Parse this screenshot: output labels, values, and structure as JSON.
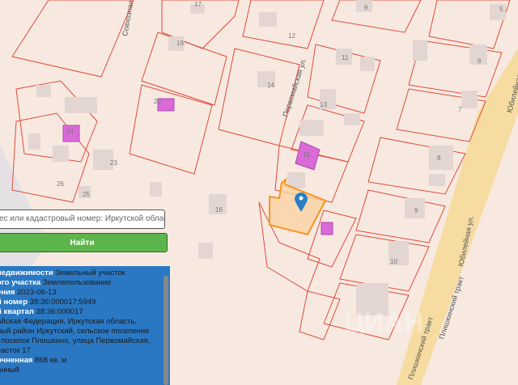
{
  "map": {
    "streets": [
      "Совхозная ул.",
      "Первомайская ул.",
      "Юбилейная ул.",
      "Плишкинский тракт"
    ],
    "house_numbers": [
      "17",
      "12",
      "9",
      "5",
      "19",
      "11",
      "6",
      "20",
      "14",
      "13",
      "7",
      "24",
      "23",
      "8",
      "15",
      "26",
      "25",
      "16",
      "9",
      "10"
    ],
    "marker": "map-pin-icon",
    "selected_color": "#f7941d",
    "parcel_color": "#e04a3a"
  },
  "search": {
    "placeholder": "ес или кадастровый номер: Иркутской области",
    "button": "Найти"
  },
  "info": {
    "rows": [
      {
        "label": "недвижимости",
        "value": "Земельный участок"
      },
      {
        "label": "ого участка",
        "value": "Землепользование"
      },
      {
        "label": "ения",
        "value": "2023-06-13"
      },
      {
        "label": "й номер",
        "value": "38:36:000017:5949"
      },
      {
        "label": "й квартал",
        "value": "38:36:000017"
      },
      {
        "label": "",
        "value": "айская Федерация, Иркутская область,"
      },
      {
        "label": "",
        "value": "ный район Иркутский, сельское поселение"
      },
      {
        "label": "",
        "value": ", поселок Плишкино, улица Первомайская,"
      },
      {
        "label": "",
        "value": "часток 17"
      },
      {
        "label": "очненная",
        "value": "868 кв. м"
      },
      {
        "label": "",
        "value": "анный"
      }
    ]
  },
  "watermark": "ЦИАН"
}
